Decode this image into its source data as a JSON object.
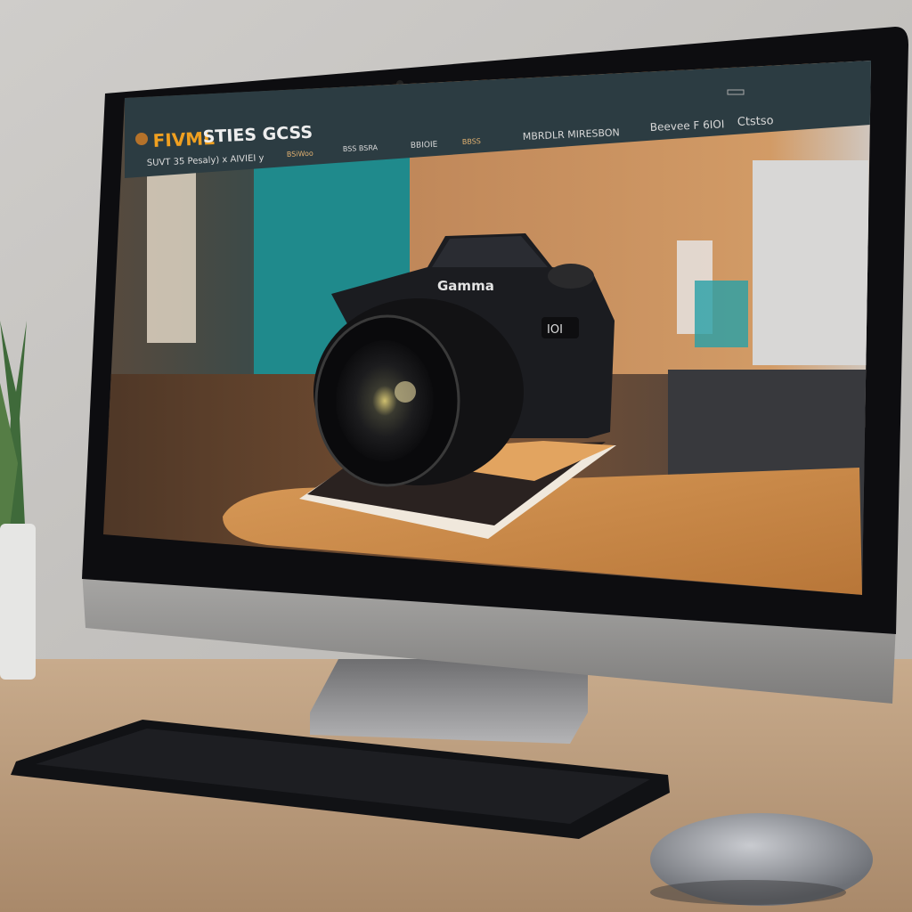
{
  "website": {
    "logo_primary": "FIVML",
    "logo_secondary": "STIES GCSS",
    "tagline": "SUVT 35 Pesaly) x AIVIEI y",
    "tagline_link": "BSiWoo",
    "nav_items": [
      "BSS BSRA",
      "BBIOIE",
      "BBSS",
      "MBRDLR MIRESBON",
      "Beevee F 6IOI",
      "Ctstso"
    ],
    "accent_color": "#f0a020",
    "nav_bar_color": "#2c3c42"
  },
  "camera": {
    "brand": "Gamma",
    "badge": "IOI"
  }
}
